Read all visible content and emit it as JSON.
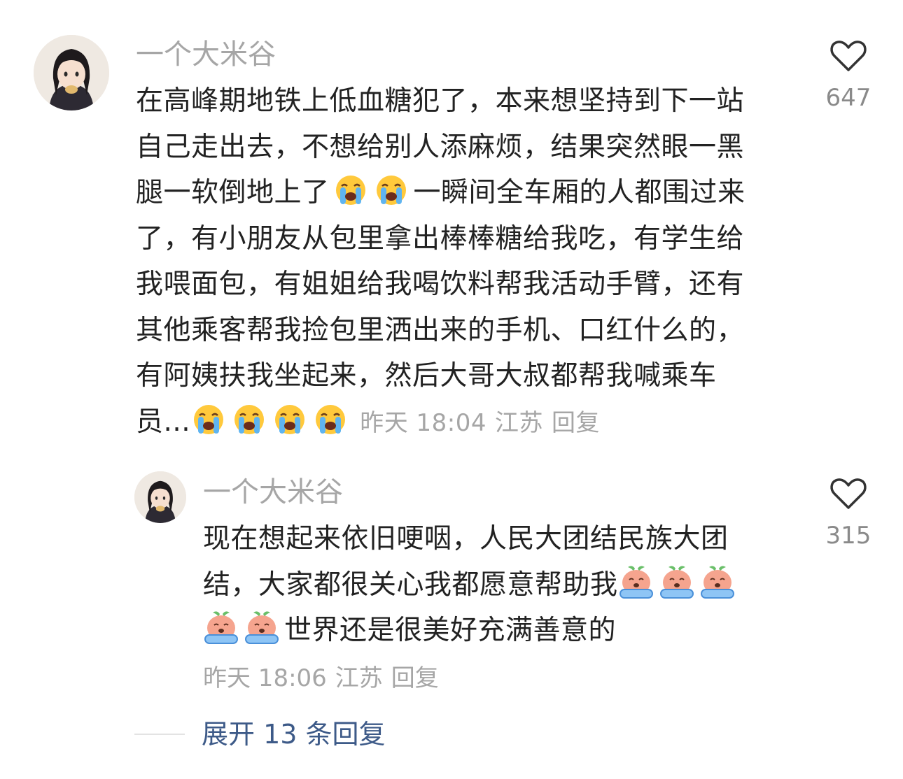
{
  "comment": {
    "username": "一个大米谷",
    "lines": [
      "在高峰期地铁上低血糖犯了，本来想坚持到下一站",
      "自己走出去，不想给别人添麻烦，结果突然眼一黑",
      "腿一软倒地上了",
      "一瞬间全车厢的人都围过来",
      "了，有小朋友从包里拿出棒棒糖给我吃，有学生给",
      "我喂面包，有姐姐给我喝饮料帮我活动手臂，还有",
      "其他乘客帮我捡包里洒出来的手机、口红什么的，",
      "有阿姨扶我坐起来，然后大哥大叔都帮我喊乘车",
      "员..."
    ],
    "emoji_name": "loudly-crying-face-emoji",
    "time": "昨天 18:04",
    "location": "江苏",
    "reply_label": "回复",
    "like_count": "647"
  },
  "reply": {
    "username": "一个大米谷",
    "lines": [
      "现在想起来依旧哽咽，人民大团结民族大团",
      "结，大家都很关心我都愿意帮助我",
      "世界还是很美好充满善意的"
    ],
    "sticker_name": "crying-peach-sticker",
    "time": "昨天 18:06",
    "location": "江苏",
    "reply_label": "回复",
    "like_count": "315"
  },
  "expand_replies": "展开 13 条回复",
  "colors": {
    "text": "#222222",
    "meta": "#a6a6a6",
    "link": "#3d5a88"
  }
}
